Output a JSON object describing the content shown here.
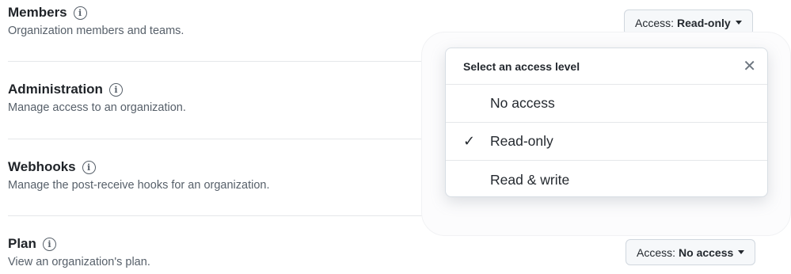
{
  "permissions": [
    {
      "title": "Members",
      "description": "Organization members and teams."
    },
    {
      "title": "Administration",
      "description": "Manage access to an organization."
    },
    {
      "title": "Webhooks",
      "description": "Manage the post-receive hooks for an organization."
    },
    {
      "title": "Plan",
      "description": "View an organization's plan."
    }
  ],
  "info_icon_glyph": "i",
  "access_prefix": "Access:",
  "members_access": "Read-only",
  "plan_access": "No access",
  "dropdown": {
    "title": "Select an access level",
    "close_glyph": "✕",
    "check_glyph": "✓",
    "options": [
      "No access",
      "Read-only",
      "Read & write"
    ],
    "selected": "Read-only"
  }
}
